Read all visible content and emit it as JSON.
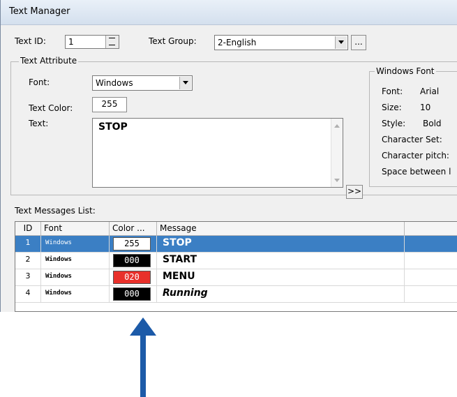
{
  "window": {
    "title": "Text Manager"
  },
  "top": {
    "text_id_label": "Text ID:",
    "text_id_value": "1",
    "text_group_label": "Text Group:",
    "text_group_value": "2-English",
    "ellipsis_label": "..."
  },
  "text_attribute": {
    "legend": "Text Attribute",
    "font_label": "Font:",
    "font_value": "Windows",
    "text_color_label": "Text Color:",
    "text_color_value": "255",
    "text_label": "Text:",
    "text_value": "STOP",
    "expand_label": ">>"
  },
  "windows_font": {
    "legend": "Windows Font",
    "font_label": "Font:",
    "font_value": "Arial",
    "size_label": "Size:",
    "size_value": "10",
    "style_label": "Style:",
    "style_value": "Bold",
    "charset_label": "Character Set:",
    "pitch_label": "Character pitch:",
    "space_label": "Space between l"
  },
  "messages": {
    "title": "Text Messages List:",
    "headers": [
      "ID",
      "Font",
      "Color ...",
      "Message"
    ],
    "rows": [
      {
        "id": "1",
        "font": "Windows",
        "color": "255",
        "message": "STOP"
      },
      {
        "id": "2",
        "font": "Windows",
        "color": "000",
        "message": "START"
      },
      {
        "id": "3",
        "font": "Windows",
        "color": "020",
        "message": "MENU"
      },
      {
        "id": "4",
        "font": "Windows",
        "color": "000",
        "message": "Running"
      }
    ]
  },
  "colors": {
    "selection": "#3b7fc4",
    "swatch_255": "#ffffff",
    "swatch_000": "#000000",
    "swatch_020": "#e8302a",
    "arrow": "#1c5aa8"
  },
  "icons": {
    "annotation": "up-arrow-icon"
  }
}
